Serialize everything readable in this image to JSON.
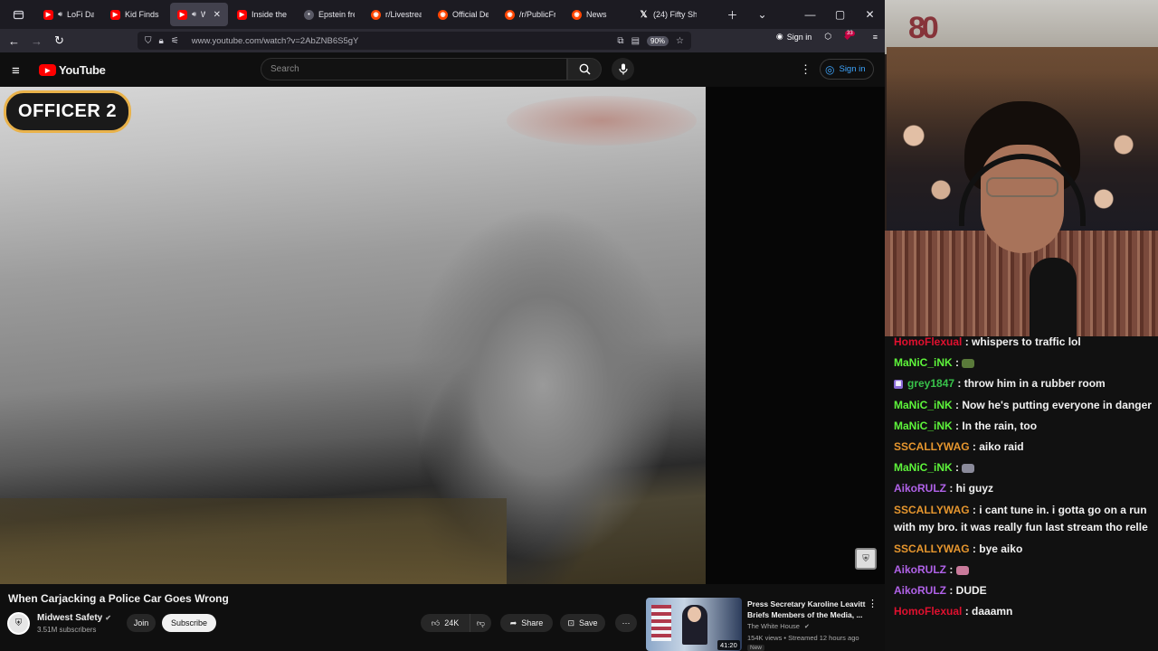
{
  "browser": {
    "tabs": [
      {
        "label": "LoFi Da",
        "favicon": "youtube",
        "audio": true,
        "active": false
      },
      {
        "label": "Kid Finds M",
        "favicon": "youtube",
        "audio": false,
        "active": false
      },
      {
        "label": "Whe",
        "favicon": "youtube",
        "audio": true,
        "active": true
      },
      {
        "label": "Inside the L",
        "favicon": "youtube",
        "audio": false,
        "active": false
      },
      {
        "label": "Epstein fre",
        "favicon": "site",
        "audio": false,
        "active": false
      },
      {
        "label": "r/Livestrea",
        "favicon": "reddit",
        "audio": false,
        "active": false
      },
      {
        "label": "Official Des",
        "favicon": "reddit",
        "audio": false,
        "active": false
      },
      {
        "label": "/r/PublicFre",
        "favicon": "reddit",
        "audio": false,
        "active": false
      },
      {
        "label": "News",
        "favicon": "reddit",
        "audio": false,
        "active": false
      },
      {
        "label": "(24) Fifty Sh",
        "favicon": "x",
        "audio": false,
        "active": false
      }
    ],
    "url": "www.youtube.com/watch?v=2AbZNB6S5gY",
    "zoom": "90%",
    "signin_label": "Sign in",
    "ext_badge": "33"
  },
  "youtube": {
    "logo_text": "YouTube",
    "search_placeholder": "Search",
    "signin_label": "Sign in",
    "overlay_label": "OFFICER 2",
    "video_title": "When Carjacking a Police Car Goes Wrong",
    "channel": {
      "name": "Midwest Safety",
      "subscribers": "3.51M subscribers",
      "join_label": "Join",
      "subscribe_label": "Subscribe"
    },
    "actions": {
      "likes": "24K",
      "share_label": "Share",
      "save_label": "Save"
    },
    "recommended": {
      "title": "Press Secretary Karoline Leavitt Briefs Members of the Media, ...",
      "channel": "The White House",
      "meta": "154K views • Streamed 12 hours ago",
      "duration": "41:20",
      "badge": "New"
    }
  },
  "stream": {
    "logo_text": "80",
    "chat": [
      {
        "user": "HomoFlexual",
        "color": "#e0102f",
        "text": "whispers to traffic lol",
        "emote": null,
        "badge": false
      },
      {
        "user": "MaNiC_iNK",
        "color": "#5ef53b",
        "text": "",
        "emote": "frog-emote",
        "badge": false
      },
      {
        "user": "grey1847",
        "color": "#38c24a",
        "text": "throw him in a rubber room",
        "emote": null,
        "badge": true
      },
      {
        "user": "MaNiC_iNK",
        "color": "#5ef53b",
        "text": "Now he's putting everyone in danger",
        "emote": null,
        "badge": false
      },
      {
        "user": "MaNiC_iNK",
        "color": "#5ef53b",
        "text": "In the rain, too",
        "emote": null,
        "badge": false
      },
      {
        "user": "SSCALLYWAG",
        "color": "#e6962e",
        "text": "aiko raid",
        "emote": null,
        "badge": false
      },
      {
        "user": "MaNiC_iNK",
        "color": "#5ef53b",
        "text": "",
        "emote": "small-emote",
        "badge": false
      },
      {
        "user": "AikoRULZ",
        "color": "#b062e8",
        "text": "hi guyz",
        "emote": null,
        "badge": false
      },
      {
        "user": "SSCALLYWAG",
        "color": "#e6962e",
        "text": "i cant tune in. i gotta go on a run with my bro. it was really fun last stream tho relle",
        "emote": null,
        "badge": false
      },
      {
        "user": "SSCALLYWAG",
        "color": "#e6962e",
        "text": "bye aiko",
        "emote": null,
        "badge": false
      },
      {
        "user": "AikoRULZ",
        "color": "#b062e8",
        "text": "",
        "emote": "pink-emote",
        "badge": false
      },
      {
        "user": "AikoRULZ",
        "color": "#b062e8",
        "text": "DUDE",
        "emote": null,
        "badge": false
      },
      {
        "user": "HomoFlexual",
        "color": "#e0102f",
        "text": "daaamn",
        "emote": null,
        "badge": false
      }
    ]
  }
}
